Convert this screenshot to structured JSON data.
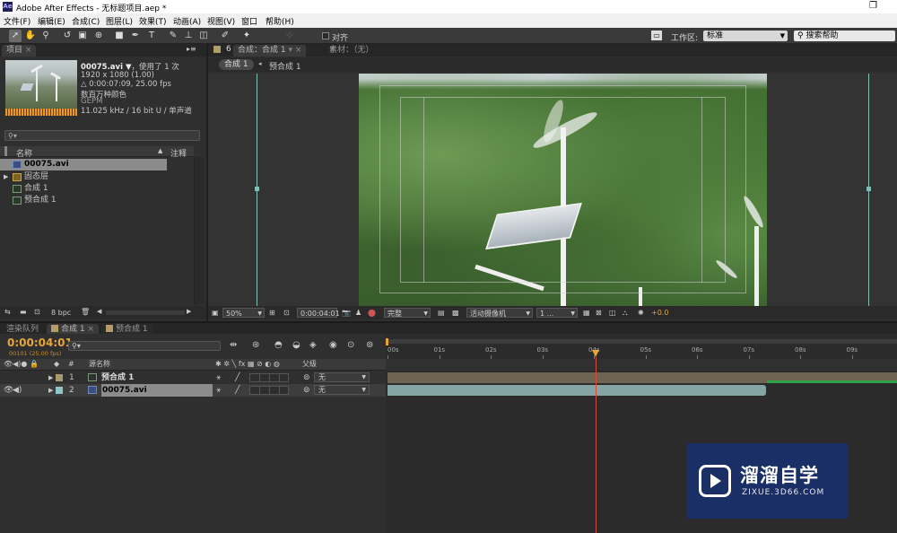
{
  "title_bar": {
    "app_icon": "Ae",
    "title": "Adobe After Effects - 无标题项目.aep *",
    "restore_glyph": "❐"
  },
  "menu": [
    "文件(F)",
    "编辑(E)",
    "合成(C)",
    "图层(L)",
    "效果(T)",
    "动画(A)",
    "视图(V)",
    "窗口",
    "帮助(H)"
  ],
  "toolbar": {
    "snap_label": "对齐",
    "workspace_label": "工作区:",
    "workspace_value": "标准",
    "search_help": "搜索帮助"
  },
  "project": {
    "tab": "项目",
    "file_name": "00075.avi ▼",
    "used": "，使用了 1 次",
    "line2": "1920 x 1080 (1.00)",
    "line3": "△ 0:00:07:09, 25.00 fps",
    "line4": "数百万种颜色",
    "line5": "GEPM",
    "line6": "11.025 kHz / 16 bit U / 单声道",
    "search_placeholder": "⚲▾",
    "col_name": "名称",
    "col_note": "注释",
    "items": [
      {
        "label": "00075.avi",
        "selected": true,
        "type": "footage"
      },
      {
        "label": "固态层",
        "selected": false,
        "type": "folder"
      },
      {
        "label": "合成 1",
        "selected": false,
        "type": "comp"
      },
      {
        "label": "预合成 1",
        "selected": false,
        "type": "comp"
      }
    ],
    "bpc": "8 bpc"
  },
  "composition": {
    "tab": "合成：合成 1",
    "footage_tab": "素材：（无）",
    "crumb1": "合成 1",
    "crumb2": "预合成 1",
    "zoom": "50%",
    "timecode": "0:00:04:01",
    "resolution": "完整",
    "camera": "活动摄像机",
    "views": "1 ...",
    "exposure": "+0.0"
  },
  "timeline": {
    "tabs": [
      "渲染队列",
      "合成 1",
      "预合成 1"
    ],
    "timecode": "0:00:04:01",
    "fps_note": "00101 (25.00 fps)",
    "search_placeholder": "⚲▾",
    "col_source": "源名称",
    "col_parent": "父级",
    "ruler": [
      "00s",
      "01s",
      "02s",
      "03s",
      "04s",
      "05s",
      "06s",
      "07s",
      "08s",
      "09s"
    ],
    "layers": [
      {
        "num": "1",
        "name": "预合成 1",
        "parent": "无",
        "color": "#a89a6a"
      },
      {
        "num": "2",
        "name": "00075.avi",
        "parent": "无",
        "color": "#8fc7c4"
      }
    ]
  },
  "watermark": {
    "brand": "溜溜自学",
    "url": "ZIXUE.3D66.COM"
  },
  "colors": {
    "timecode": "#e7a53a",
    "playhead": "#d94a3a",
    "precomp_bar": "#6d6552",
    "footage_bar": "#8fb3b1",
    "guide": "#7fbfb6"
  }
}
